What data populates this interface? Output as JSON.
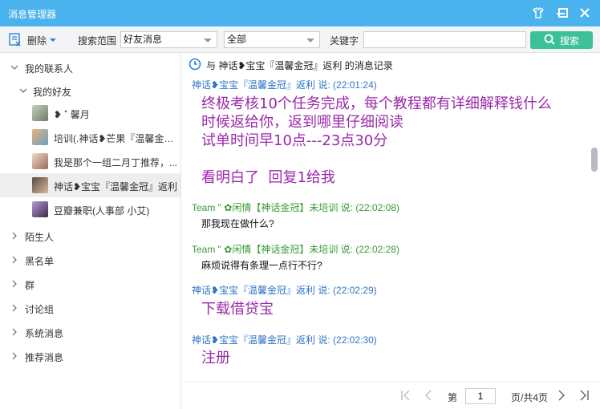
{
  "window": {
    "title": "消息管理器"
  },
  "toolbar": {
    "delete_label": "删除",
    "search_scope_label": "搜索范围",
    "scope_select": "好友消息",
    "range_select": "全部",
    "keyword_label": "关键字",
    "keyword_value": "",
    "search_label": "搜索"
  },
  "sidebar": {
    "my_contacts": "我的联系人",
    "my_friends": "我的好友",
    "contacts": [
      {
        "name": "❥ ˚ 馨月"
      },
      {
        "name": "培训(.神话❥芒果『温馨金冠..."
      },
      {
        "name": "我是那个一组二月丁推荐，..."
      },
      {
        "name": "神话❥宝宝『温馨金冠』返利"
      },
      {
        "name": "豆瓣兼职(人事部 小艾)"
      }
    ],
    "groups": [
      "陌生人",
      "黑名单",
      "群",
      "讨论组",
      "系统消息",
      "推荐消息"
    ]
  },
  "main": {
    "header": "与 神话❥宝宝『温馨金冠』返利 的消息记录",
    "messages": [
      {
        "meta": "神话❥宝宝『温馨金冠』返利 说: (22:01:24)",
        "body": "终极考核10个任务完成，每个教程都有详细解释钱什么\n时候返给你，返到哪里仔细阅读\n试单时间早10点---23点30分\n\n看明白了  回复1给我"
      },
      {
        "meta": "Team \" ✿闲情【神话金冠】未培训 说: (22:02:08)",
        "body": "那我现在做什么?"
      },
      {
        "meta": "Team \" ✿闲情【神话金冠】未培训 说: (22:02:28)",
        "body": "麻烦说得有条理一点行不行?"
      },
      {
        "meta": "神话❥宝宝『温馨金冠』返利 说: (22:02:29)",
        "body": "下载借贷宝"
      },
      {
        "meta": "神话❥宝宝『温馨金冠』返利 说: (22:02:30)",
        "body": "注册"
      }
    ]
  },
  "pagination": {
    "prefix": "第",
    "current_page": "1",
    "suffix": "页/共4页"
  },
  "colors": {
    "titlebar": "#4ab2ec",
    "search_button": "#3cc098",
    "sender_blue": "#2f74c8",
    "sender_green": "#3a9a36",
    "message_purple": "#9a2aa8"
  }
}
